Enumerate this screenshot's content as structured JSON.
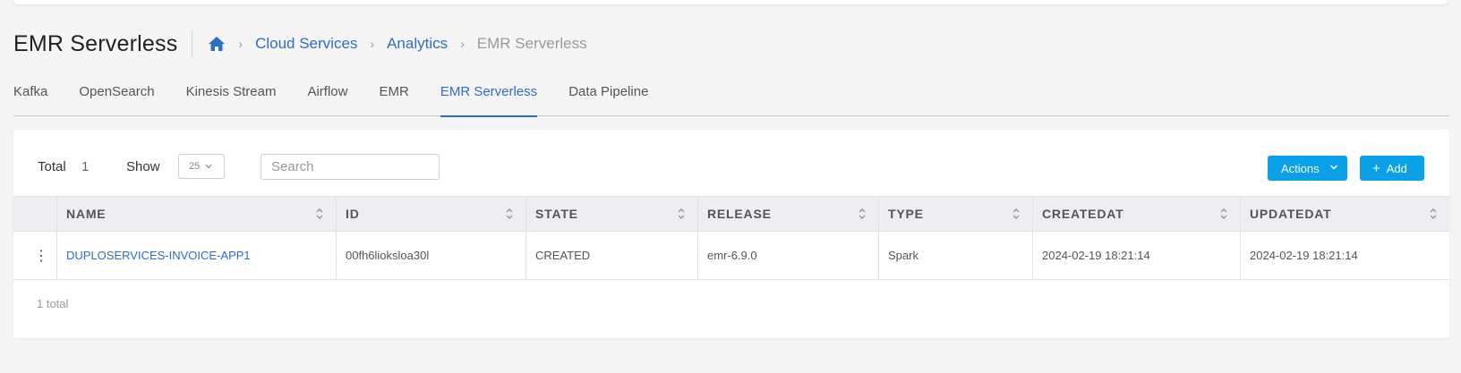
{
  "header": {
    "title": "EMR Serverless",
    "breadcrumb": {
      "home_icon": "home-icon",
      "items": [
        "Cloud Services",
        "Analytics"
      ],
      "current": "EMR Serverless"
    }
  },
  "tabs": [
    {
      "label": "Kafka",
      "active": false
    },
    {
      "label": "OpenSearch",
      "active": false
    },
    {
      "label": "Kinesis Stream",
      "active": false
    },
    {
      "label": "Airflow",
      "active": false
    },
    {
      "label": "EMR",
      "active": false
    },
    {
      "label": "EMR Serverless",
      "active": true
    },
    {
      "label": "Data Pipeline",
      "active": false
    }
  ],
  "toolbar": {
    "total_label": "Total",
    "total_value": "1",
    "show_label": "Show",
    "page_size": "25",
    "search_placeholder": "Search",
    "actions_label": "Actions",
    "add_label": "Add"
  },
  "table": {
    "columns": [
      "NAME",
      "ID",
      "STATE",
      "RELEASE",
      "TYPE",
      "CREATEDAT",
      "UPDATEDAT"
    ],
    "rows": [
      {
        "name": "DUPLOSERVICES-INVOICE-APP1",
        "id": "00fh6lioksloa30l",
        "state": "CREATED",
        "release": "emr-6.9.0",
        "type": "Spark",
        "createdat": "2024-02-19 18:21:14",
        "updatedat": "2024-02-19 18:21:14"
      }
    ]
  },
  "footer": {
    "total_text": "1 total"
  },
  "colors": {
    "accent": "#2c6fc4",
    "button": "#0aa1e8",
    "header_bg": "#eeeef2",
    "page_bg": "#f5f5f6"
  }
}
